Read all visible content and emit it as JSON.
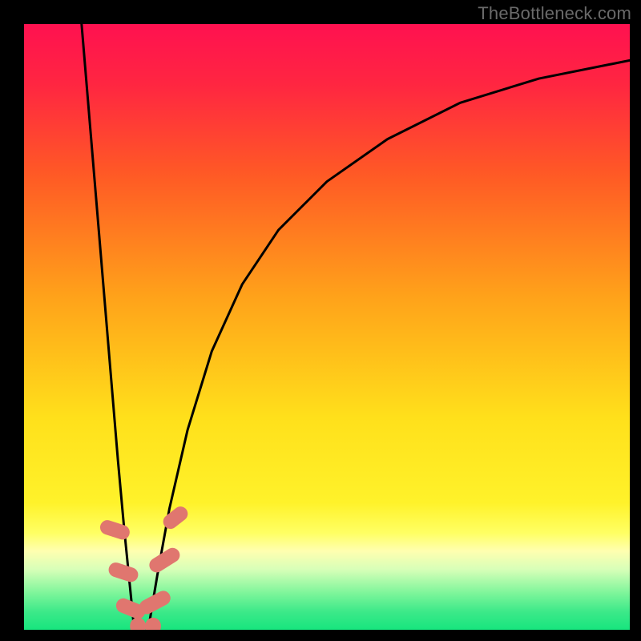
{
  "watermark": "TheBottleneck.com",
  "chart_data": {
    "type": "line",
    "title": "",
    "xlabel": "",
    "ylabel": "",
    "xlim": [
      0,
      100
    ],
    "ylim": [
      0,
      100
    ],
    "grid": false,
    "legend": false,
    "gradient_stops": [
      {
        "offset": 0.0,
        "color": "#ff1150"
      },
      {
        "offset": 0.1,
        "color": "#ff2641"
      },
      {
        "offset": 0.25,
        "color": "#ff5a25"
      },
      {
        "offset": 0.45,
        "color": "#ffa21a"
      },
      {
        "offset": 0.65,
        "color": "#ffe01b"
      },
      {
        "offset": 0.79,
        "color": "#fff22a"
      },
      {
        "offset": 0.84,
        "color": "#ffff63"
      },
      {
        "offset": 0.87,
        "color": "#ffffb0"
      },
      {
        "offset": 0.9,
        "color": "#d8ffb8"
      },
      {
        "offset": 0.94,
        "color": "#7cf59a"
      },
      {
        "offset": 0.97,
        "color": "#3de989"
      },
      {
        "offset": 1.0,
        "color": "#17e57e"
      }
    ],
    "series": [
      {
        "name": "left-branch",
        "x": [
          9.5,
          10.5,
          11.5,
          12.5,
          13.5,
          14.5,
          15.5,
          16.5,
          17.5,
          18.2
        ],
        "values": [
          100,
          88,
          76,
          64,
          52,
          40,
          28,
          17,
          7,
          0
        ]
      },
      {
        "name": "right-branch",
        "x": [
          20.5,
          22,
          24,
          27,
          31,
          36,
          42,
          50,
          60,
          72,
          85,
          100
        ],
        "values": [
          0,
          9,
          20,
          33,
          46,
          57,
          66,
          74,
          81,
          87,
          91,
          94
        ]
      }
    ],
    "markers": [
      {
        "name": "left-top",
        "x": 15.0,
        "y": 16.5,
        "w": 2.4,
        "h": 5,
        "angle": -72
      },
      {
        "name": "left-mid",
        "x": 16.4,
        "y": 9.5,
        "w": 2.4,
        "h": 5,
        "angle": -72
      },
      {
        "name": "left-low",
        "x": 17.6,
        "y": 3.5,
        "w": 2.4,
        "h": 5,
        "angle": -68
      },
      {
        "name": "bottom-left",
        "x": 18.8,
        "y": 0.6,
        "w": 2.6,
        "h": 2.8,
        "angle": 0
      },
      {
        "name": "bottom-right",
        "x": 21.3,
        "y": 0.6,
        "w": 2.6,
        "h": 2.8,
        "angle": 0
      },
      {
        "name": "right-low",
        "x": 21.6,
        "y": 4.5,
        "w": 2.4,
        "h": 5.5,
        "angle": 62
      },
      {
        "name": "right-mid",
        "x": 23.2,
        "y": 11.5,
        "w": 2.4,
        "h": 5.5,
        "angle": 58
      },
      {
        "name": "right-top",
        "x": 25.0,
        "y": 18.5,
        "w": 2.4,
        "h": 4.5,
        "angle": 52
      }
    ]
  }
}
